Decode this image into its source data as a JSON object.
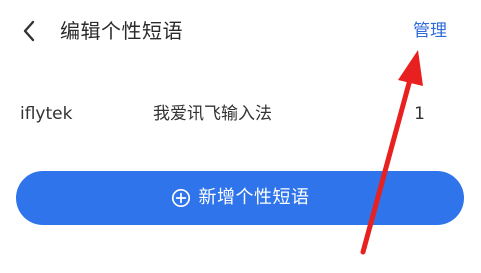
{
  "header": {
    "back_icon": "chevron-left-icon",
    "title": "编辑个性短语",
    "manage_label": "管理"
  },
  "phrases": [
    {
      "user": "iflytek",
      "phrase": "我爱讯飞输入法",
      "index": "1"
    }
  ],
  "add_button": {
    "icon": "plus-circle-icon",
    "label": "新增个性短语"
  },
  "colors": {
    "accent": "#2f74eb",
    "link": "#2f6bd9",
    "annotation_arrow": "#e8201f"
  }
}
